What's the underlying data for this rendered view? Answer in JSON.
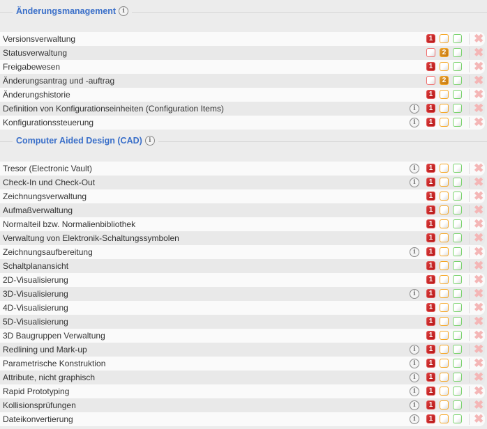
{
  "sections": [
    {
      "title": "Änderungsmanagement",
      "rows": [
        {
          "label": "Versionsverwaltung",
          "info": false,
          "level": 1
        },
        {
          "label": "Statusverwaltung",
          "info": false,
          "level": 2
        },
        {
          "label": "Freigabewesen",
          "info": false,
          "level": 1
        },
        {
          "label": "Änderungsantrag und -auftrag",
          "info": false,
          "level": 2
        },
        {
          "label": "Änderungshistorie",
          "info": false,
          "level": 1
        },
        {
          "label": "Definition von Konfigurationseinheiten (Configuration Items)",
          "info": true,
          "level": 1
        },
        {
          "label": "Konfigurationssteuerung",
          "info": true,
          "level": 1
        }
      ]
    },
    {
      "title": "Computer Aided Design (CAD)",
      "rows": [
        {
          "label": "Tresor (Electronic Vault)",
          "info": true,
          "level": 1
        },
        {
          "label": "Check-In und Check-Out",
          "info": true,
          "level": 1
        },
        {
          "label": "Zeichnungsverwaltung",
          "info": false,
          "level": 1
        },
        {
          "label": "Aufmaßverwaltung",
          "info": false,
          "level": 1
        },
        {
          "label": "Normalteil bzw. Normalienbibliothek",
          "info": false,
          "level": 1
        },
        {
          "label": "Verwaltung von Elektronik-Schaltungssymbolen",
          "info": false,
          "level": 1
        },
        {
          "label": "Zeichnungsaufbereitung",
          "info": true,
          "level": 1
        },
        {
          "label": "Schaltplanansicht",
          "info": false,
          "level": 1
        },
        {
          "label": "2D-Visualisierung",
          "info": false,
          "level": 1
        },
        {
          "label": "3D-Visualisierung",
          "info": true,
          "level": 1
        },
        {
          "label": "4D-Visualisierung",
          "info": false,
          "level": 1
        },
        {
          "label": "5D-Visualisierung",
          "info": false,
          "level": 1
        },
        {
          "label": "3D Baugruppen Verwaltung",
          "info": false,
          "level": 1
        },
        {
          "label": "Redlining und Mark-up",
          "info": true,
          "level": 1
        },
        {
          "label": "Parametrische Konstruktion",
          "info": true,
          "level": 1
        },
        {
          "label": "Attribute, nicht graphisch",
          "info": true,
          "level": 1
        },
        {
          "label": "Rapid Prototyping",
          "info": true,
          "level": 1
        },
        {
          "label": "Kollisionsprüfungen",
          "info": true,
          "level": 1
        },
        {
          "label": "Dateikonvertierung",
          "info": true,
          "level": 1
        }
      ]
    }
  ],
  "info_glyph": "i",
  "delete_glyph": "✖",
  "colors": {
    "title": "#3a6fc9",
    "level1": "#c62828",
    "level2": "#d4881a",
    "level3": "#77d26a"
  }
}
